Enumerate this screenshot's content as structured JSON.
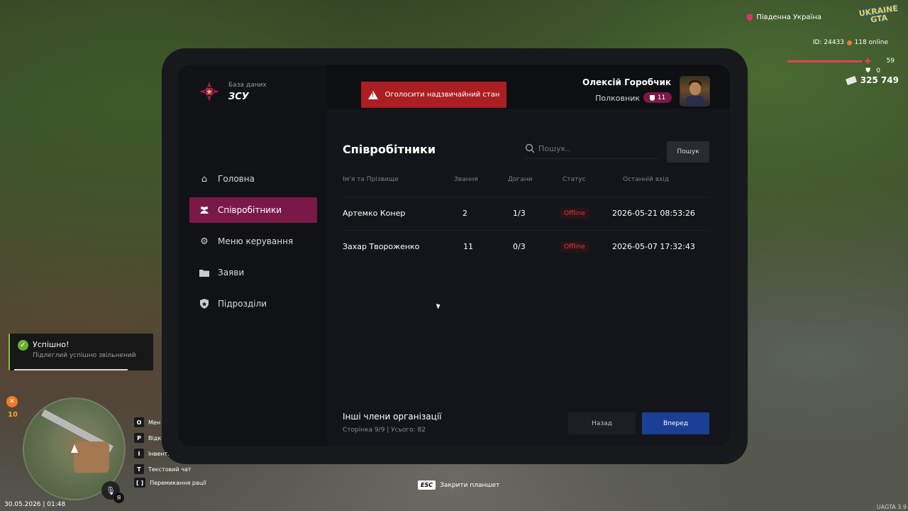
{
  "hud": {
    "region": "Південна Україна",
    "game_logo": [
      "UKRAINE",
      "GTA"
    ],
    "player_id": "ID: 24433",
    "online": "118 online",
    "health": "59",
    "armor": "0",
    "money": "325 749",
    "hunger": "10",
    "datetime": "30.05.2026 | 01:48",
    "version": "UAGTA 3.9",
    "language": "Я",
    "hotkeys": [
      {
        "key": "O",
        "label": "Мен"
      },
      {
        "key": "P",
        "label": "Відк"
      },
      {
        "key": "I",
        "label": "Інвент."
      },
      {
        "key": "T",
        "label": "Текстовий чат"
      },
      {
        "key": "[  ]",
        "label": "Перемикання рації"
      }
    ],
    "esc_key": "ESC",
    "esc_label": "Закрити планшет"
  },
  "notification": {
    "title": "Успішно!",
    "text": "Підлеглий успішно звільнений"
  },
  "brand": {
    "subtitle": "База даних",
    "title": "ЗСУ"
  },
  "emergency_button": "Оголосити надзвичайний стан",
  "user": {
    "name": "Олексій Горобчик",
    "rank": "Полковник",
    "rank_level": "11"
  },
  "nav": [
    {
      "label": "Головна",
      "icon": "home-icon"
    },
    {
      "label": "Співробітники",
      "icon": "users-icon",
      "active": true
    },
    {
      "label": "Меню керування",
      "icon": "gear-icon"
    },
    {
      "label": "Заяви",
      "icon": "folder-icon"
    },
    {
      "label": "Підрозділи",
      "icon": "shield-icon"
    }
  ],
  "page": {
    "title": "Співробітники",
    "search_placeholder": "Пошук..",
    "search_button": "Пошук"
  },
  "table": {
    "headers": [
      "Ім'я та Прізвище",
      "Звання",
      "Догани",
      "Статус",
      "Останній вхід"
    ],
    "rows": [
      {
        "name": "Артемко Конер",
        "rank": "2",
        "reprimands": "1/3",
        "status": "Offline",
        "last_login": "2026-05-21 08:53:26"
      },
      {
        "name": "Захар Твороженко",
        "rank": "11",
        "reprimands": "0/3",
        "status": "Offline",
        "last_login": "2026-05-07 17:32:43"
      }
    ]
  },
  "footer": {
    "title": "Інші члени організації",
    "pagination": "Сторінка 9/9 | Усього: 82",
    "back": "Назад",
    "next": "Вперед"
  },
  "colors": {
    "accent": "#7a1948",
    "danger": "#ab1e22",
    "primary": "#1c3f96",
    "status_offline": "#e23b3b",
    "success": "#69b22e"
  }
}
